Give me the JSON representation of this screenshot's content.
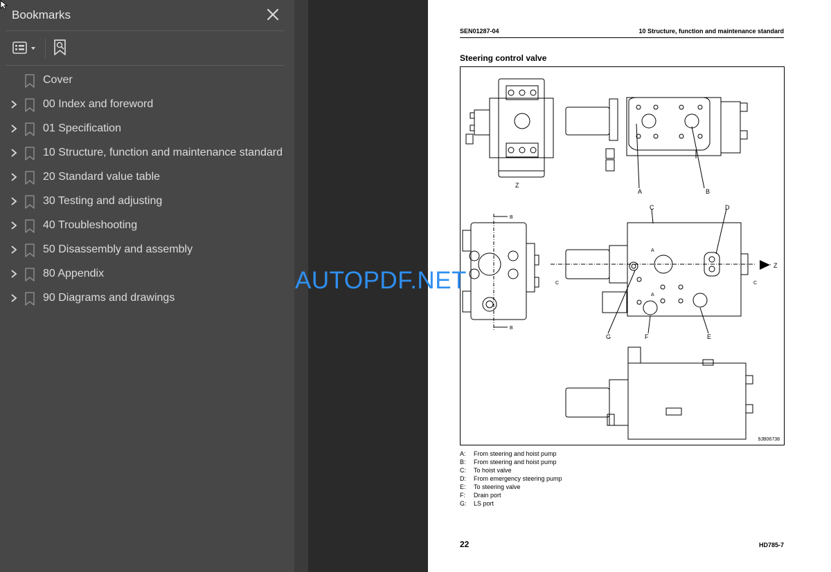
{
  "sidebar": {
    "title": "Bookmarks",
    "close_icon": "close-icon",
    "tools": {
      "options_icon": "bookmark-options-icon",
      "find_icon": "find-bookmark-icon"
    },
    "bookmarks": [
      {
        "label": "Cover",
        "expandable": false
      },
      {
        "label": "00 Index and foreword",
        "expandable": true
      },
      {
        "label": "01 Specification",
        "expandable": true
      },
      {
        "label": "10 Structure, function and maintenance standard",
        "expandable": true
      },
      {
        "label": "20 Standard value table",
        "expandable": true
      },
      {
        "label": "30 Testing and adjusting",
        "expandable": true
      },
      {
        "label": "40 Troubleshooting",
        "expandable": true
      },
      {
        "label": "50 Disassembly and assembly",
        "expandable": true
      },
      {
        "label": "80 Appendix",
        "expandable": true
      },
      {
        "label": "90 Diagrams and drawings",
        "expandable": true
      }
    ]
  },
  "page": {
    "doc_id": "SEN01287-04",
    "chapter": "10 Structure, function and maintenance standard",
    "section_title": "Steering control valve",
    "figure": {
      "code": "9JB06738",
      "labels": {
        "z_top": "Z",
        "a": "A",
        "b": "B",
        "c": "C",
        "d": "D",
        "e": "E",
        "f": "F",
        "g": "G",
        "z_arrow": "Z",
        "b_marker": "B",
        "c_marker": "C"
      }
    },
    "legend": [
      {
        "key": "A:",
        "text": "From steering and hoist pump"
      },
      {
        "key": "B:",
        "text": "From steering and hoist pump"
      },
      {
        "key": "C:",
        "text": "To hoist valve"
      },
      {
        "key": "D:",
        "text": "From emergency steering pump"
      },
      {
        "key": "E:",
        "text": "To steering valve"
      },
      {
        "key": "F:",
        "text": "Drain port"
      },
      {
        "key": "G:",
        "text": "LS port"
      }
    ],
    "page_number": "22",
    "model": "HD785-7"
  },
  "watermark": "AUTOPDF.NET",
  "colors": {
    "sidebar_bg": "#474747",
    "viewer_bg": "#2a2a2a",
    "watermark": "#2f8ff0"
  }
}
